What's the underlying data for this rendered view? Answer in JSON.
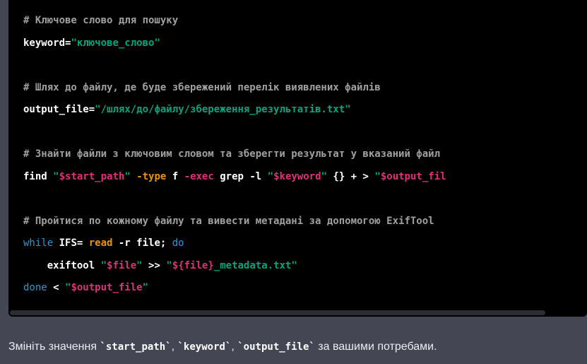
{
  "code": {
    "lines": [
      [
        {
          "t": "# Ключове слово для пошуку",
          "c": "comment"
        }
      ],
      [
        {
          "t": "keyword",
          "c": "plain"
        },
        {
          "t": "=",
          "c": "punct"
        },
        {
          "t": "\"ключове_слово\"",
          "c": "string"
        }
      ],
      [],
      [
        {
          "t": "# Шлях до файлу, де буде збережений перелік виявлених файлів",
          "c": "comment"
        }
      ],
      [
        {
          "t": "output_file",
          "c": "plain"
        },
        {
          "t": "=",
          "c": "punct"
        },
        {
          "t": "\"/шлях/до/файлу/збереження_результатів.txt\"",
          "c": "string"
        }
      ],
      [],
      [
        {
          "t": "# Знайти файли з ключовим словом та зберегти результат у вказаний файл",
          "c": "comment"
        }
      ],
      [
        {
          "t": "find ",
          "c": "plain"
        },
        {
          "t": "\"",
          "c": "string"
        },
        {
          "t": "$start_path",
          "c": "var"
        },
        {
          "t": "\"",
          "c": "string"
        },
        {
          "t": " ",
          "c": "plain"
        },
        {
          "t": "-type",
          "c": "flag"
        },
        {
          "t": " f ",
          "c": "plain"
        },
        {
          "t": "-exec",
          "c": "var"
        },
        {
          "t": " grep -l ",
          "c": "plain"
        },
        {
          "t": "\"",
          "c": "string"
        },
        {
          "t": "$keyword",
          "c": "var"
        },
        {
          "t": "\"",
          "c": "string"
        },
        {
          "t": " {} + > ",
          "c": "plain"
        },
        {
          "t": "\"",
          "c": "string"
        },
        {
          "t": "$output_fil",
          "c": "var"
        }
      ],
      [],
      [
        {
          "t": "# Пройтися по кожному файлу та вивести метадані за допомогою ExifTool",
          "c": "comment"
        }
      ],
      [
        {
          "t": "while",
          "c": "kw"
        },
        {
          "t": " IFS= ",
          "c": "plain"
        },
        {
          "t": "read",
          "c": "flag"
        },
        {
          "t": " -r file; ",
          "c": "plain"
        },
        {
          "t": "do",
          "c": "kw"
        }
      ],
      [
        {
          "t": "    exiftool ",
          "c": "plain"
        },
        {
          "t": "\"",
          "c": "string"
        },
        {
          "t": "$file",
          "c": "var"
        },
        {
          "t": "\"",
          "c": "string"
        },
        {
          "t": " >> ",
          "c": "plain"
        },
        {
          "t": "\"",
          "c": "string"
        },
        {
          "t": "${file}",
          "c": "var"
        },
        {
          "t": "_metadata.txt\"",
          "c": "string"
        }
      ],
      [
        {
          "t": "done",
          "c": "kw"
        },
        {
          "t": " < ",
          "c": "plain"
        },
        {
          "t": "\"",
          "c": "string"
        },
        {
          "t": "$output_file",
          "c": "var"
        },
        {
          "t": "\"",
          "c": "string"
        }
      ]
    ]
  },
  "footer": {
    "prefix": "Змініть значення ",
    "code1": "`start_path`",
    "sep1": ", ",
    "code2": "`keyword`",
    "sep2": ", ",
    "code3": "`output_file`",
    "suffix": " за вашими потребами."
  },
  "colors": {
    "background": "#444654",
    "code_bg": "#000000",
    "comment": "#a0a0a0",
    "string": "#00a67d",
    "variable": "#df3079",
    "keyword": "#2e95d3",
    "flag": "#e9950c"
  }
}
